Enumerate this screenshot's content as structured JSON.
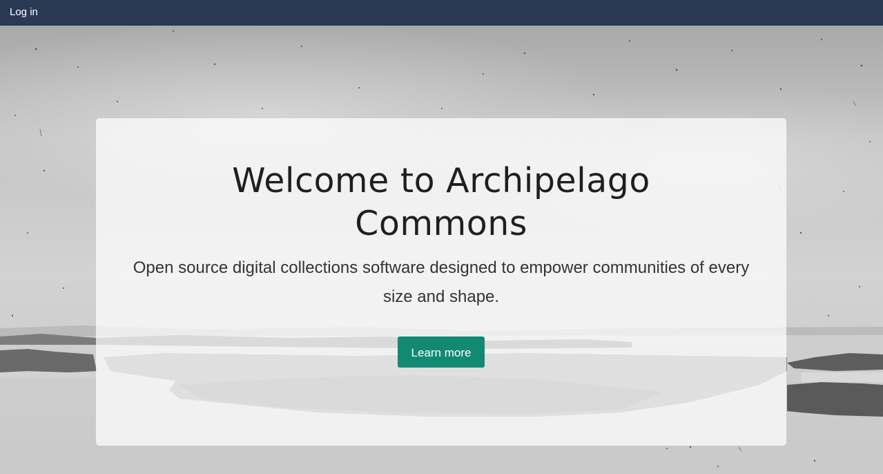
{
  "nav": {
    "login_label": "Log in"
  },
  "hero": {
    "title_line1": "Welcome to Archipelago",
    "title_line2": "Commons",
    "tagline": "Open source digital collections software designed to empower communities of every size and shape.",
    "cta_label": "Learn more"
  },
  "colors": {
    "topbar": "#2a3a55",
    "cta": "#128a73",
    "title_text": "#1f1f1f"
  }
}
